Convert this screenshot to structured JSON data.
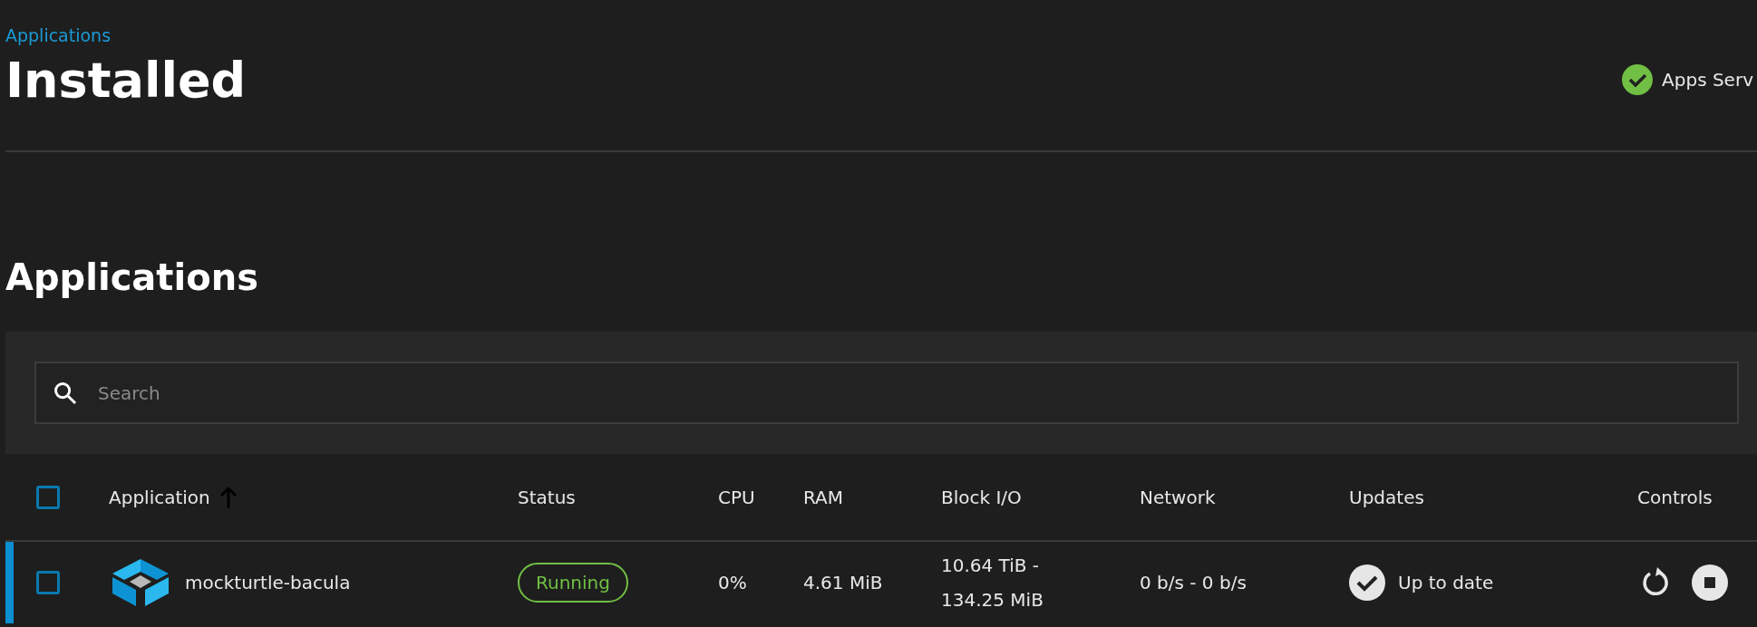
{
  "breadcrumb": "Applications",
  "page_title": "Installed",
  "service_status": {
    "label": "Apps Serv",
    "ok": true
  },
  "section_title": "Applications",
  "search": {
    "placeholder": "Search"
  },
  "table": {
    "select_all_checked": false,
    "columns": [
      {
        "label": "Application",
        "sorted": true,
        "ascending": true
      },
      {
        "label": "Status"
      },
      {
        "label": "CPU"
      },
      {
        "label": "RAM"
      },
      {
        "label": "Block I/O"
      },
      {
        "label": "Network"
      },
      {
        "label": "Updates"
      },
      {
        "label": "Controls"
      }
    ],
    "rows": [
      {
        "selected": true,
        "checked": false,
        "name": "mockturtle-bacula",
        "status": "Running",
        "running": true,
        "cpu": "0%",
        "ram": "4.61 MiB",
        "block_io": [
          "10.64 TiB -",
          "134.25 MiB"
        ],
        "network": "0 b/s - 0 b/s",
        "updates": "Up to date",
        "up_to_date": true
      }
    ]
  }
}
